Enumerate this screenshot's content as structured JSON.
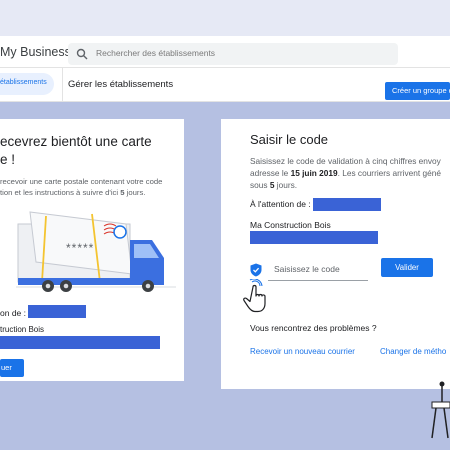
{
  "header": {
    "brand": "My Business",
    "search_placeholder": "Rechercher des établissements"
  },
  "subheader": {
    "nav_item": "établissements",
    "title": "Gérer les établissements",
    "create_button": "Créer un groupe d'ét"
  },
  "left_card": {
    "title_line1": "ecevrez bientôt une carte",
    "title_line2": "e !",
    "body_line1": "recevoir une carte postale contenant votre code",
    "body_line2_pre": "tion et les instructions à suivre d'ici ",
    "body_line2_bold": "5",
    "body_line2_post": " jours.",
    "card_code": "*****",
    "attention": "on de :",
    "company": "truction Bois",
    "button": "uer"
  },
  "right_card": {
    "title": "Saisir le code",
    "body_line1": "Saisissez le code de validation à cinq chiffres envoy",
    "body_line2_pre": "adresse le ",
    "body_line2_bold": "15 juin 2019",
    "body_line2_post": ". Les courriers arrivent géné",
    "body_line3_pre": "sous ",
    "body_line3_bold": "5",
    "body_line3_post": " jours.",
    "attention": "À l'attention de :",
    "company": "Ma Construction Bois",
    "code_placeholder": "Saisissez le code",
    "validate_button": "Valider",
    "problems": "Vous rencontrez des problèmes ?",
    "link_new_mail": "Recevoir un nouveau courrier",
    "link_change_method": "Changer de métho"
  },
  "colors": {
    "accent": "#1a73e8",
    "redaction": "#3a63d6",
    "background": "#b5c0e2"
  }
}
